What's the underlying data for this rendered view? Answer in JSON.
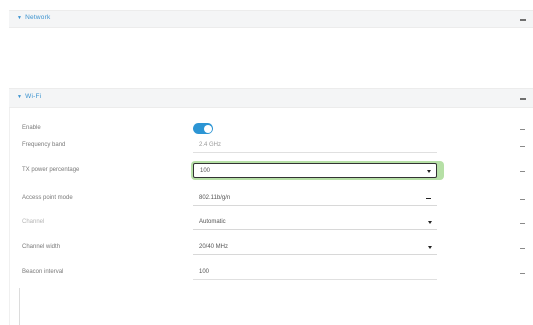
{
  "panels": {
    "network": {
      "title": "Network"
    },
    "wifi": {
      "title": "Wi-Fi"
    }
  },
  "icons": {
    "expanded": "caret-down-icon",
    "collapse": "minus-icon",
    "select": "chevron-down-icon"
  },
  "fields": {
    "enable": {
      "label": "Enable",
      "value": true
    },
    "frequency_band": {
      "label": "Frequency band",
      "value": "2.4 GHz"
    },
    "tx_power": {
      "label": "TX power percentage",
      "value": "100"
    },
    "access_point_mode": {
      "label": "Access point mode",
      "value": "802.11b/g/n"
    },
    "channel": {
      "label": "Channel",
      "value": "Automatic"
    },
    "channel_width": {
      "label": "Channel width",
      "value": "20/40 MHz"
    },
    "beacon_interval": {
      "label": "Beacon interval",
      "value": "100"
    }
  },
  "colors": {
    "accent": "#3a92cf",
    "toggle_on": "#2c95d4",
    "focus_ring": "#b6e0a6"
  }
}
